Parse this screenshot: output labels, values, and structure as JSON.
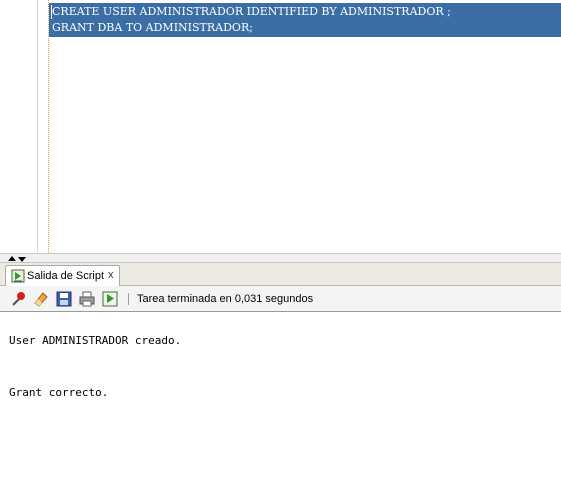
{
  "editor": {
    "lines": [
      "CREATE USER ADMINISTRADOR IDENTIFIED BY ADMINISTRADOR ;",
      "GRANT DBA TO ADMINISTRADOR;"
    ]
  },
  "panel": {
    "tab_label": "Salida de Script",
    "tab_close": "x",
    "tab_icon": "script-output-icon"
  },
  "toolbar": {
    "icons": [
      "pin-icon",
      "eraser-icon",
      "save-icon",
      "print-icon",
      "run-script-icon"
    ],
    "status": "Tarea terminada en 0,031 segundos"
  },
  "output": {
    "lines": [
      "User ADMINISTRADOR creado.",
      "Grant correcto."
    ]
  },
  "colors": {
    "selection": "#3a6ea5",
    "toolbar_bg": "#f4f4f4"
  }
}
